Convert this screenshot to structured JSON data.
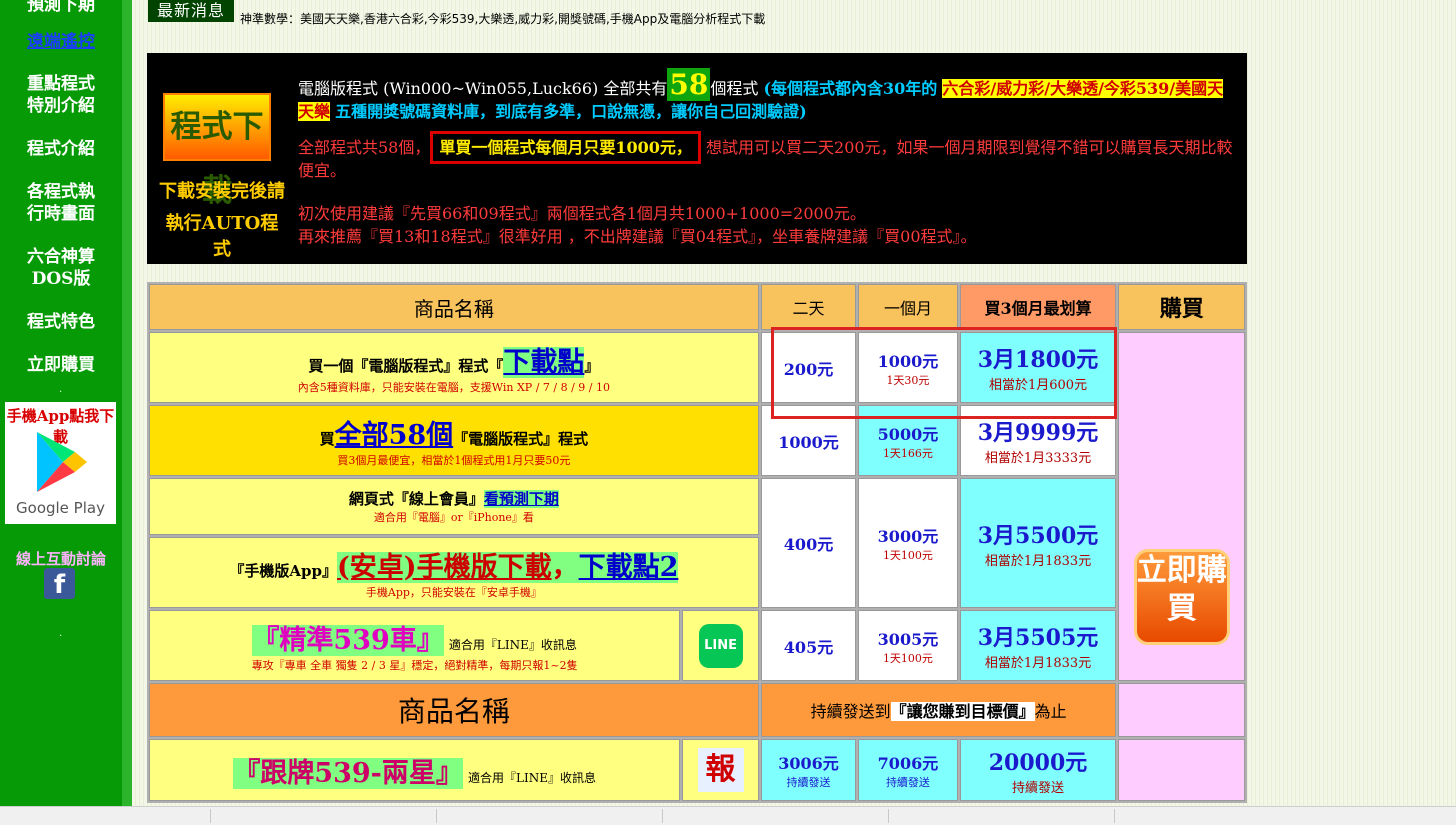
{
  "sidebar": {
    "top_partial": "預測下期",
    "remote": "遠端遙控",
    "items": [
      {
        "line1": "重點程式",
        "line2": "特別介紹"
      },
      {
        "line1": "程式介紹",
        "line2": ""
      },
      {
        "line1": "各程式執",
        "line2": "行時畫面"
      },
      {
        "line1": "六合神算",
        "line2": "DOS版"
      },
      {
        "line1": "程式特色",
        "line2": ""
      },
      {
        "line1": "立即購買",
        "line2": ""
      }
    ],
    "app_download": "手機App點我下載",
    "google_play": "Google Play",
    "discussion": "線上互動討論",
    "fb_icon": "f"
  },
  "news": {
    "label": "最新消息",
    "text": "神準數學：美國天天樂,香港六合彩,今彩539,大樂透,威力彩,開獎號碼,手機App及電腦分析程式下載"
  },
  "banner": {
    "logo_title": "程式下載",
    "logo_sub1": "下載安裝完後請",
    "logo_sub2": "執行AUTO程式",
    "p1_a": "電腦版程式 (Win000~Win055,Luck66) 全部共有",
    "p1_num": "58",
    "p1_b": "個程式",
    "p1_c": "(每個程式都內含30年的",
    "p1_hl1": "六合彩/威力彩/大樂透/今彩539/美國天天樂",
    "p1_d": "五種開獎號碼資料庫，到底有多準，口說無憑，讓你自己回測驗證)",
    "p2_a": "全部程式共58個，",
    "p2_box": "單買一個程式每個月只要1000元，",
    "p2_b": "想試用可以買二天200元，如果一個月期限到覺得不錯可以購買長天期比較便宜。",
    "p3": "初次使用建議『先買66和09程式』兩個程式各1個月共1000+1000=2000元。",
    "p4": "再來推薦『買13和18程式』很準好用 ，不出牌建議『買04程式』，坐車養牌建議『買00程式』。"
  },
  "table": {
    "headers": [
      "商品名稱",
      "二天",
      "一個月",
      "買3個月最划算",
      "購買"
    ],
    "rows": [
      {
        "title_a": "買一個『電腦版程式』程式『",
        "title_link": "下載點",
        "title_b": "』",
        "note": "內含5種資料庫，只能安裝在電腦，支援Win XP / 7 / 8 / 9 / 10",
        "two_day": "200元",
        "month": "1000元",
        "month_day": "1天30元",
        "m3": "3月1800元",
        "m3_sub": "相當於1月600元"
      },
      {
        "title_a": "買",
        "title_link": "全部58個",
        "title_b": "『電腦版程式』程式",
        "note": "買3個月最便宜，相當於1個程式用1月只要50元",
        "two_day": "1000元",
        "month": "5000元",
        "month_day": "1天166元",
        "m3": "3月9999元",
        "m3_sub": "相當於1月3333元"
      },
      {
        "title_a": "網頁式『線上會員』",
        "title_link": "看預測下期",
        "note": "適合用『電腦』or『iPhone』看",
        "app_title": "『手機版App』",
        "app_link1": "(安卓)手機版下載",
        "app_comma": "，",
        "app_link2": "下載點2",
        "app_note": "手機App，只能安裝在『安卓手機』",
        "two_day": "400元",
        "month": "3000元",
        "month_day": "1天100元",
        "m3": "3月5500元",
        "m3_sub": "相當於1月1833元"
      },
      {
        "title": "『精準539車』",
        "side": "適合用『LINE』收訊息",
        "note": "專攻『專車 全車 獨隻 2 / 3 星』穩定，絕對精準，每期只報1~2隻",
        "icon_text": "LINE",
        "two_day": "405元",
        "month": "3005元",
        "month_day": "1天100元",
        "m3": "3月5505元",
        "m3_sub": "相當於1月1833元"
      }
    ],
    "buy_button": "立即購買",
    "section2_header": "商品名稱",
    "section2_note_a": "持續發送到",
    "section2_note_hl": "『讓您賺到目標價』",
    "section2_note_b": "為止",
    "row5": {
      "title": "『跟牌539-兩星』",
      "side": "適合用『LINE』收訊息",
      "icon_text": "報",
      "two_day": "3006元",
      "two_day_sub": "持續發送",
      "month": "7006元",
      "month_sub": "持續發送",
      "m3": "20000元",
      "m3_sub": "持續發送"
    }
  },
  "colors": {
    "sidebar_green": "#069b06",
    "banner_black": "#000000",
    "header_orange": "#f8c25c",
    "cyan_cell": "#80ffff",
    "highlight_red": "#dd2222"
  }
}
